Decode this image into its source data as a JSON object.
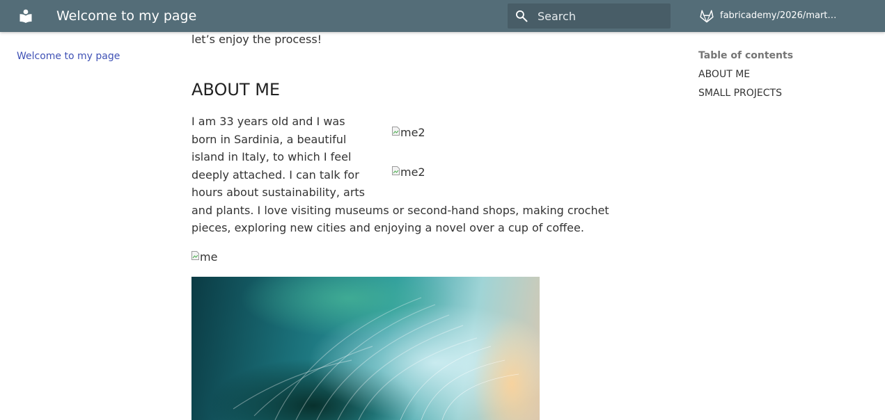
{
  "header": {
    "site_title": "Welcome to my page",
    "logo_icon": "book-icon",
    "search": {
      "placeholder": "Search",
      "value": "",
      "icon": "search-icon"
    },
    "repo": {
      "label": "fabricademy/2026/marti…",
      "icon": "gitlab-icon"
    },
    "color": "#546d78"
  },
  "left_nav": {
    "items": [
      {
        "label": "Welcome to my page"
      }
    ]
  },
  "main": {
    "intro_tail": "let’s enjoy the process!",
    "about_heading": "ABOUT ME",
    "bio": "I am 33 years old and I was born in Sardinia, a beautiful island in Italy, to which I feel deeply attached. I can talk for hours about sustainability, arts and plants. I love visiting museums or second-hand shops, making crochet pieces, exploring new cities and enjoying a novel over a cup of coffee.",
    "images": [
      {
        "alt": "me2"
      },
      {
        "alt": "me2"
      },
      {
        "alt": "me"
      }
    ]
  },
  "toc": {
    "title": "Table of contents",
    "items": [
      {
        "label": "ABOUT ME"
      },
      {
        "label": "SMALL PROJECTS"
      }
    ]
  }
}
